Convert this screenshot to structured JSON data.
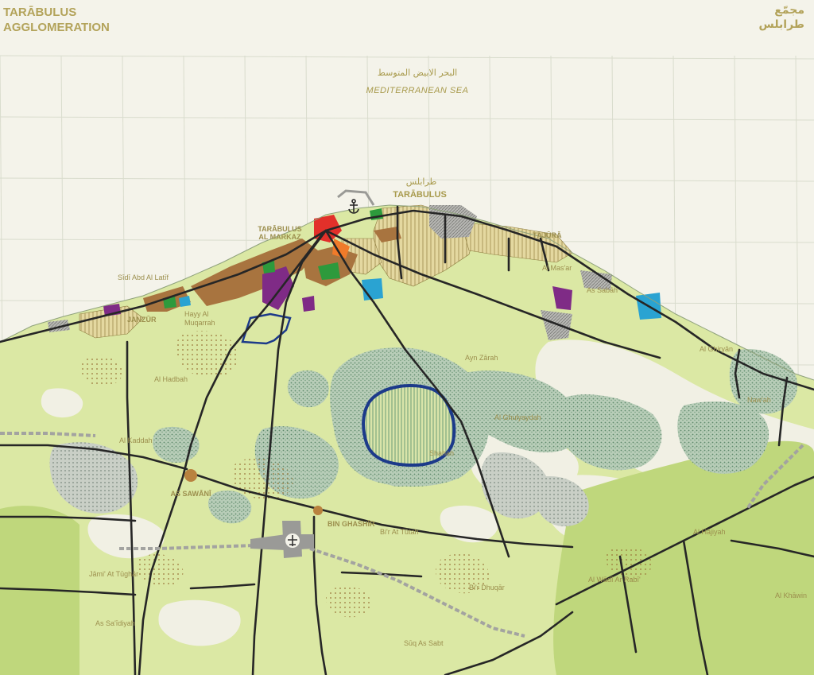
{
  "title": {
    "line1": "TARĀBULUS",
    "line2": "AGGLOMERATION"
  },
  "title_ar": {
    "line1": "مجمّع",
    "line2": "طرابلس"
  },
  "sea": {
    "arabic": "البحر الابيض المتوسط",
    "english": "MEDITERRANEAN SEA"
  },
  "city": {
    "arabic": "طرابلس",
    "name": "TARĀBULUS"
  },
  "places": {
    "markaz_1": "TARĀBULUS",
    "markaz_2": "AL MARKAZ",
    "tajura": "TĀJŪRĀ",
    "sidi_abd": "Sīdī Abd Al Latīf",
    "janzur": "JANZŪR",
    "hayy_1": "Hayy Al",
    "hayy_2": "Muqarrah",
    "ghiryan": "Al Ghiryān",
    "ghulyaydah": "Al Ghulyaydah",
    "ayn_zarah": "Ayn Zārah",
    "sawani": "AS SAWĀNĪ",
    "bin_ghashir": "BIN GHASHĪR",
    "bir_tutah": "Bi'r At Tūtah",
    "jami_tughar": "Jāmi' At Tūghār",
    "as_sa_idiyah": "As Sa'īdiyah",
    "al_mas_ar": "Al Mas'ar",
    "as_sabah": "As Sabāh",
    "wadi_rabi": "Al Wādī Ar Rabī'",
    "bir_dhuqar": "Bi'r Dhuqār",
    "suq_sabt": "Sūq As Sabt",
    "al_hadbah": "Al Hadbah",
    "al_kaddah": "Al Kaddah",
    "naw_ah": "Naw'ah",
    "al_hajiyah": "Al Hājiyah",
    "al_khawin": "Al Khāwin",
    "shahah": "Shahah"
  },
  "colors": {
    "background": "#f4f3ea",
    "grid": "#d9dccd",
    "land_green": "#dbe8a4",
    "bright_green": "#bfd77c",
    "forest": "#8fae93",
    "urban_tan": "#d8c989",
    "urban_brown": "#a8743f",
    "industrial_grey": "#a3a3a0",
    "road": "#262626",
    "label": "#a89a4c",
    "boundary_blue": "#1c3a8a",
    "center_red": "#e2302a",
    "purple": "#7f2b86",
    "cyan": "#2aa3d2"
  },
  "icons": [
    "anchor-icon",
    "airport-icon"
  ]
}
